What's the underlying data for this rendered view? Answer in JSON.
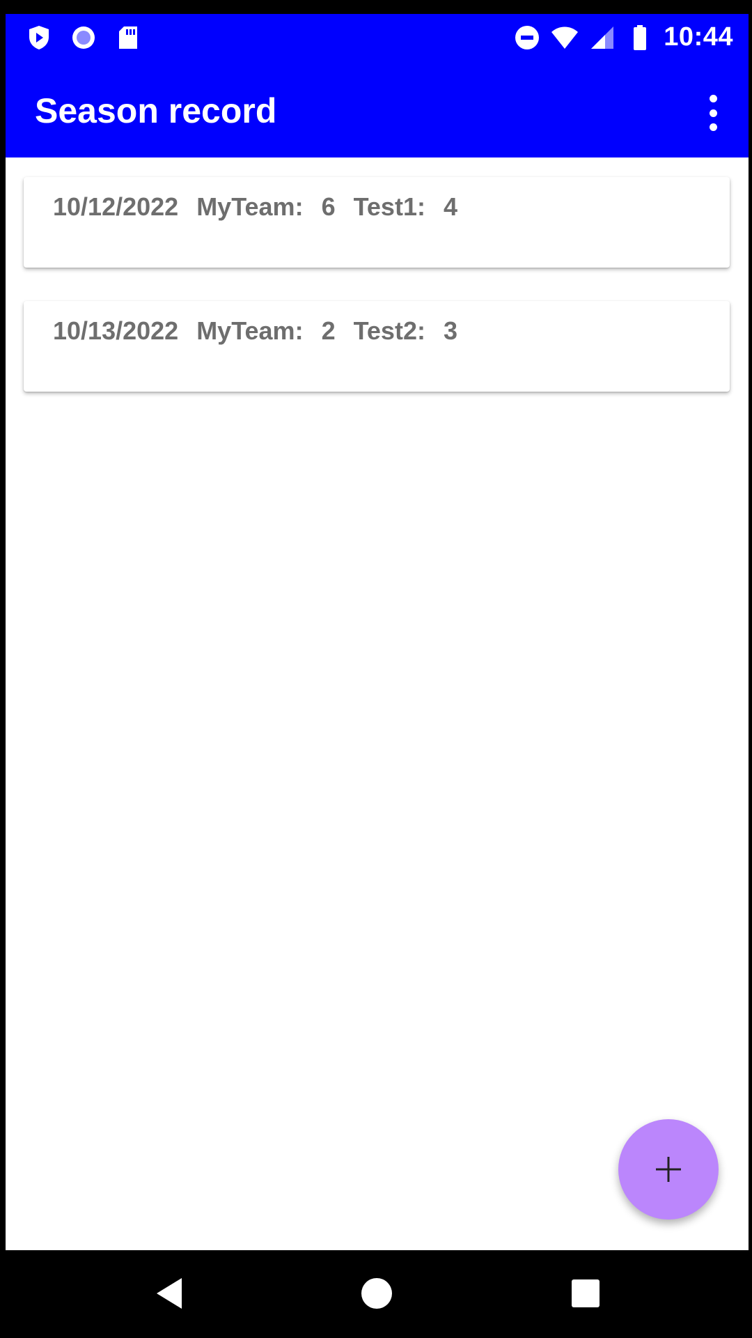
{
  "status_bar": {
    "time": "10:44",
    "left_icons": [
      "play-protect-icon",
      "circle-notification-icon",
      "sd-card-icon"
    ],
    "right_icons": [
      "do-not-disturb-icon",
      "wifi-icon",
      "cell-signal-icon",
      "battery-icon"
    ]
  },
  "app_bar": {
    "title": "Season record",
    "menu_icon": "more-vert-icon"
  },
  "games": [
    {
      "date": "10/12/2022",
      "team_label": "MyTeam:",
      "team_score": "6",
      "opponent_label": "Test1:",
      "opponent_score": "4"
    },
    {
      "date": "10/13/2022",
      "team_label": "MyTeam:",
      "team_score": "2",
      "opponent_label": "Test2:",
      "opponent_score": "3"
    }
  ],
  "fab": {
    "icon": "plus-icon"
  },
  "nav_bar": {
    "icons": [
      "back-icon",
      "home-icon",
      "recents-icon"
    ]
  },
  "colors": {
    "primary": "#0000fe",
    "fab": "#bb86fc",
    "card_text": "#6e6e6e",
    "background": "#ffffff"
  }
}
